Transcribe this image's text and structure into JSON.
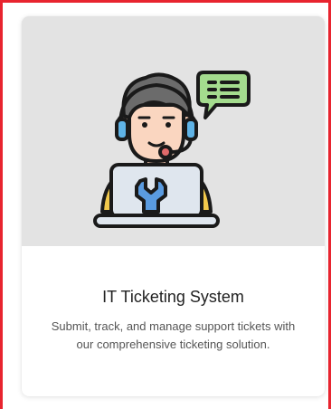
{
  "card": {
    "title": "IT Ticketing System",
    "description": "Submit, track, and manage support tickets with our comprehensive ticketing solution.",
    "image_icon": "support-agent-laptop-icon"
  },
  "colors": {
    "selection_outline": "#e8242f",
    "hero_background": "#e3e3e3"
  }
}
